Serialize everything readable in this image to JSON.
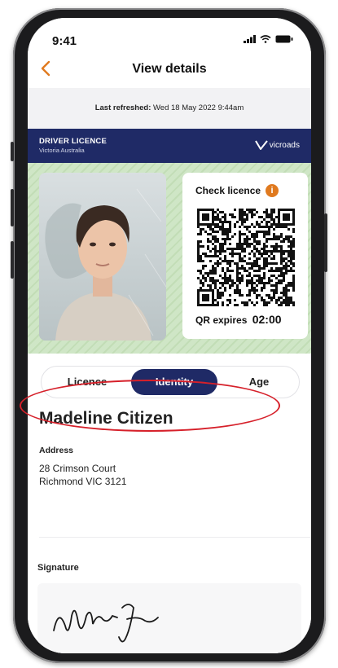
{
  "status_bar": {
    "time": "9:41"
  },
  "nav": {
    "back_icon": "chevron-left-icon",
    "title": "View details"
  },
  "refresh": {
    "label": "Last refreshed:",
    "value": "Wed 18 May 2022 9:44am"
  },
  "licence_banner": {
    "title": "DRIVER LICENCE",
    "subtitle": "Victoria Australia",
    "brand": "vicroads"
  },
  "qr_panel": {
    "heading": "Check licence",
    "info_icon": "info-icon",
    "info_glyph": "i",
    "expires_label": "QR expires",
    "expires_value": "02:00"
  },
  "tabs": [
    {
      "label": "Licence",
      "active": false
    },
    {
      "label": "Identity",
      "active": true
    },
    {
      "label": "Age",
      "active": false
    }
  ],
  "person": {
    "name": "Madeline Citizen"
  },
  "address": {
    "label": "Address",
    "line1": "28 Crimson Court",
    "line2": "Richmond VIC 3121"
  },
  "signature": {
    "label": "Signature"
  },
  "colors": {
    "accent": "#e07a1f",
    "brand_navy": "#1f2a66",
    "annotation_red": "#d6202a",
    "card_green": "#cfe6c6"
  }
}
